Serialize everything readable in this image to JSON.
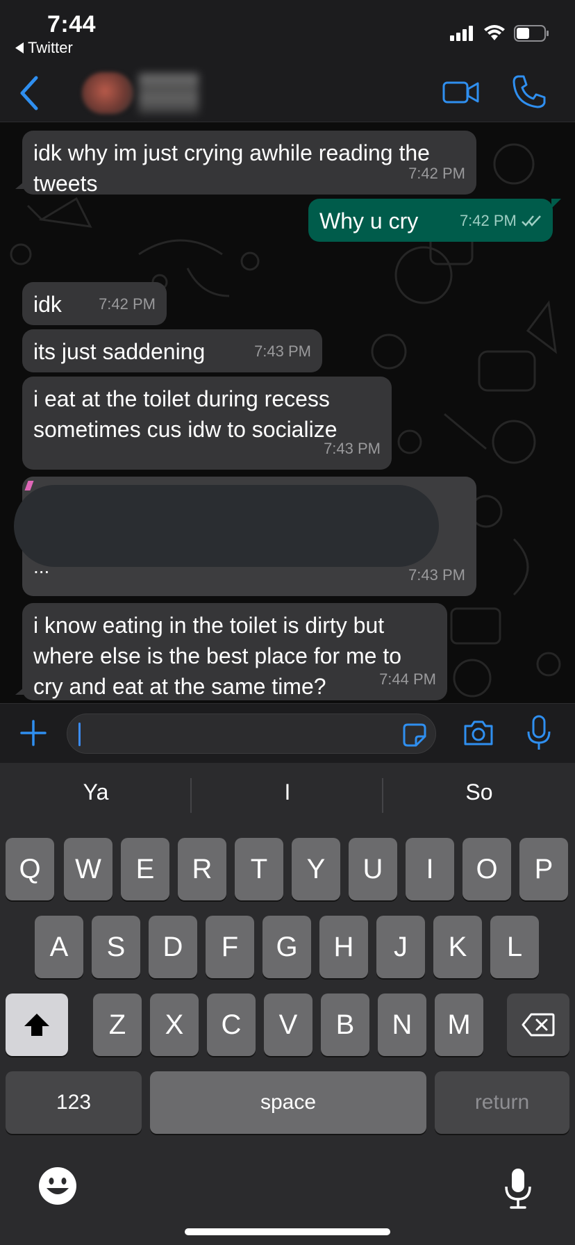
{
  "status_bar": {
    "time": "7:44",
    "back_app": "Twitter",
    "icons": [
      "signal-icon",
      "wifi-icon",
      "battery-icon"
    ]
  },
  "header": {
    "back_icon": "chevron-left-icon",
    "video_icon": "video-camera-icon",
    "call_icon": "phone-icon",
    "accent_color": "#2f8ff0"
  },
  "messages": [
    {
      "direction": "in",
      "text": "idk why im just crying awhile reading the tweets",
      "time": "7:42 PM"
    },
    {
      "direction": "out",
      "text": "Why u cry",
      "time": "7:42 PM",
      "status": "read"
    },
    {
      "direction": "in",
      "text": "idk",
      "time": "7:42 PM"
    },
    {
      "direction": "in",
      "text": "its just saddening",
      "time": "7:43 PM"
    },
    {
      "direction": "in",
      "text": "i eat at the toilet during recess sometimes cus idw to socialize",
      "time": "7:43 PM"
    },
    {
      "direction": "in",
      "text": "...",
      "time": "7:43 PM",
      "redacted": true
    },
    {
      "direction": "in",
      "text": "i know eating in the toilet is dirty but where else is the best place for me to cry and eat at the same time?",
      "time": "7:44 PM"
    }
  ],
  "input": {
    "value": "",
    "icons": [
      "plus-icon",
      "sticker-icon",
      "camera-icon",
      "microphone-icon"
    ]
  },
  "keyboard": {
    "suggestions": [
      "Ya",
      "I",
      "So"
    ],
    "row1": [
      "Q",
      "W",
      "E",
      "R",
      "T",
      "Y",
      "U",
      "I",
      "O",
      "P"
    ],
    "row2": [
      "A",
      "S",
      "D",
      "F",
      "G",
      "H",
      "J",
      "K",
      "L"
    ],
    "row3": [
      "Z",
      "X",
      "C",
      "V",
      "B",
      "N",
      "M"
    ],
    "numbers_label": "123",
    "space_label": "space",
    "return_label": "return",
    "icons": [
      "shift-icon",
      "backspace-icon",
      "emoji-icon",
      "dictation-icon"
    ]
  },
  "colors": {
    "outgoing_bubble": "#005c4b",
    "incoming_bubble": "#363638",
    "chat_background": "#0c0c0c"
  }
}
